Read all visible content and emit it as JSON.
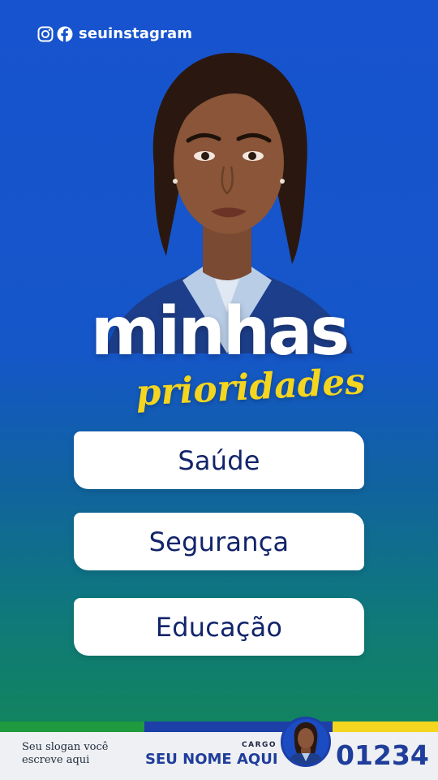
{
  "header": {
    "instagram_icon": "instagram-icon",
    "facebook_icon": "facebook-icon",
    "handle": "seuinstagram"
  },
  "headline": {
    "main": "minhas",
    "sub": "prioridades"
  },
  "priorities": [
    {
      "label": "Saúde"
    },
    {
      "label": "Segurança"
    },
    {
      "label": "Educação"
    }
  ],
  "footer": {
    "slogan": "Seu slogan você escreve aqui",
    "cargo_label": "CARGO",
    "candidate_name": "SEU NOME AQUI",
    "candidate_number": "01234"
  },
  "colors": {
    "background_top": "#1753cf",
    "background_bottom": "#12845f",
    "accent_yellow": "#f4d51f",
    "navy": "#12246a",
    "stripe_green": "#1f9a3e",
    "stripe_blue": "#1c3fa8",
    "stripe_yellow": "#f4d51f"
  }
}
